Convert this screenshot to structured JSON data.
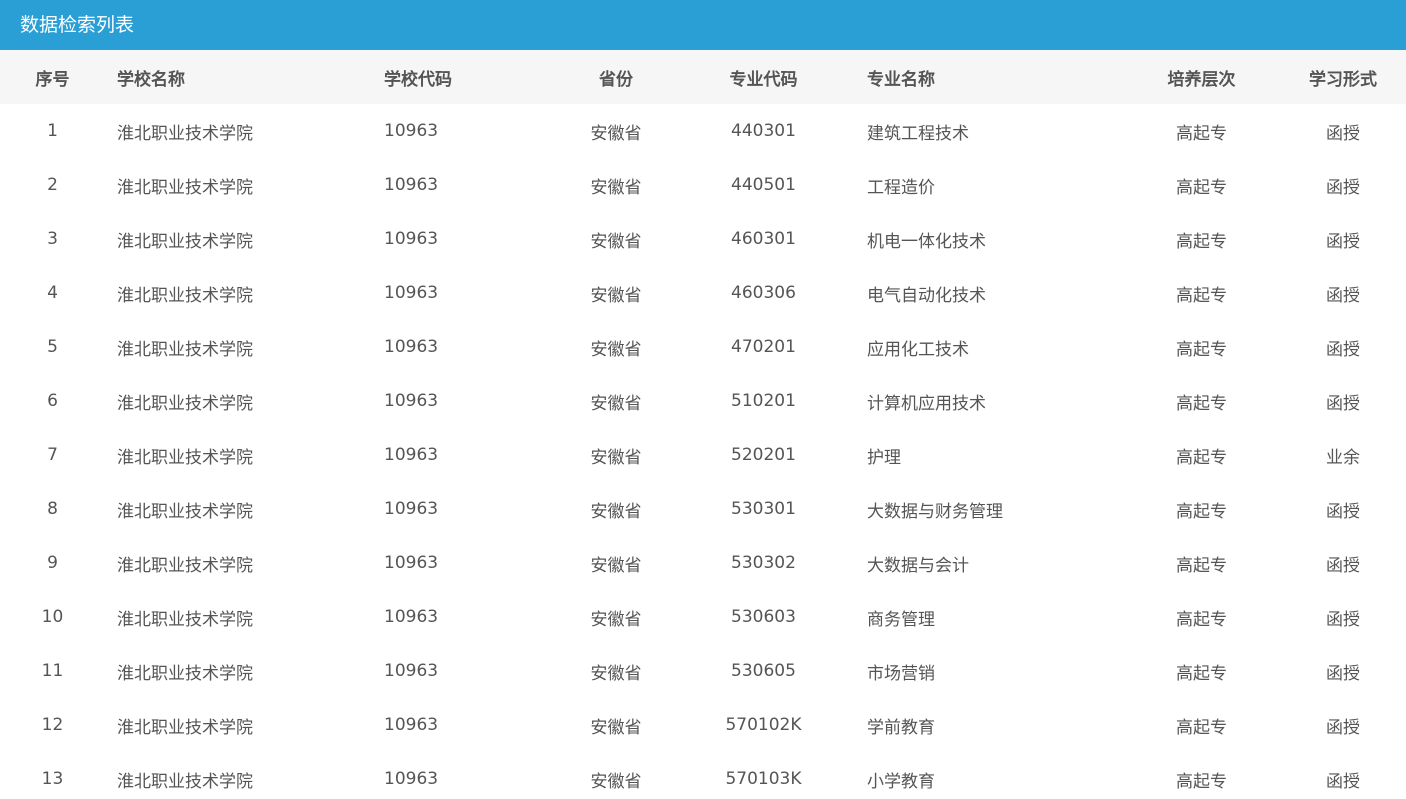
{
  "panel": {
    "title": "数据检索列表"
  },
  "table": {
    "headers": {
      "seq": "序号",
      "school": "学校名称",
      "school_code": "学校代码",
      "province": "省份",
      "major_code": "专业代码",
      "major": "专业名称",
      "level": "培养层次",
      "form": "学习形式"
    },
    "rows": [
      {
        "seq": "1",
        "school": "淮北职业技术学院",
        "school_code": "10963",
        "province": "安徽省",
        "major_code": "440301",
        "major": "建筑工程技术",
        "level": "高起专",
        "form": "函授"
      },
      {
        "seq": "2",
        "school": "淮北职业技术学院",
        "school_code": "10963",
        "province": "安徽省",
        "major_code": "440501",
        "major": "工程造价",
        "level": "高起专",
        "form": "函授"
      },
      {
        "seq": "3",
        "school": "淮北职业技术学院",
        "school_code": "10963",
        "province": "安徽省",
        "major_code": "460301",
        "major": "机电一体化技术",
        "level": "高起专",
        "form": "函授"
      },
      {
        "seq": "4",
        "school": "淮北职业技术学院",
        "school_code": "10963",
        "province": "安徽省",
        "major_code": "460306",
        "major": "电气自动化技术",
        "level": "高起专",
        "form": "函授"
      },
      {
        "seq": "5",
        "school": "淮北职业技术学院",
        "school_code": "10963",
        "province": "安徽省",
        "major_code": "470201",
        "major": "应用化工技术",
        "level": "高起专",
        "form": "函授"
      },
      {
        "seq": "6",
        "school": "淮北职业技术学院",
        "school_code": "10963",
        "province": "安徽省",
        "major_code": "510201",
        "major": "计算机应用技术",
        "level": "高起专",
        "form": "函授"
      },
      {
        "seq": "7",
        "school": "淮北职业技术学院",
        "school_code": "10963",
        "province": "安徽省",
        "major_code": "520201",
        "major": "护理",
        "level": "高起专",
        "form": "业余"
      },
      {
        "seq": "8",
        "school": "淮北职业技术学院",
        "school_code": "10963",
        "province": "安徽省",
        "major_code": "530301",
        "major": "大数据与财务管理",
        "level": "高起专",
        "form": "函授"
      },
      {
        "seq": "9",
        "school": "淮北职业技术学院",
        "school_code": "10963",
        "province": "安徽省",
        "major_code": "530302",
        "major": "大数据与会计",
        "level": "高起专",
        "form": "函授"
      },
      {
        "seq": "10",
        "school": "淮北职业技术学院",
        "school_code": "10963",
        "province": "安徽省",
        "major_code": "530603",
        "major": "商务管理",
        "level": "高起专",
        "form": "函授"
      },
      {
        "seq": "11",
        "school": "淮北职业技术学院",
        "school_code": "10963",
        "province": "安徽省",
        "major_code": "530605",
        "major": "市场营销",
        "level": "高起专",
        "form": "函授"
      },
      {
        "seq": "12",
        "school": "淮北职业技术学院",
        "school_code": "10963",
        "province": "安徽省",
        "major_code": "570102K",
        "major": "学前教育",
        "level": "高起专",
        "form": "函授"
      },
      {
        "seq": "13",
        "school": "淮北职业技术学院",
        "school_code": "10963",
        "province": "安徽省",
        "major_code": "570103K",
        "major": "小学教育",
        "level": "高起专",
        "form": "函授"
      }
    ]
  },
  "colors": {
    "header_bar": "#2a9fd5",
    "table_header_bg": "#f6f6f6",
    "text": "#555555"
  }
}
